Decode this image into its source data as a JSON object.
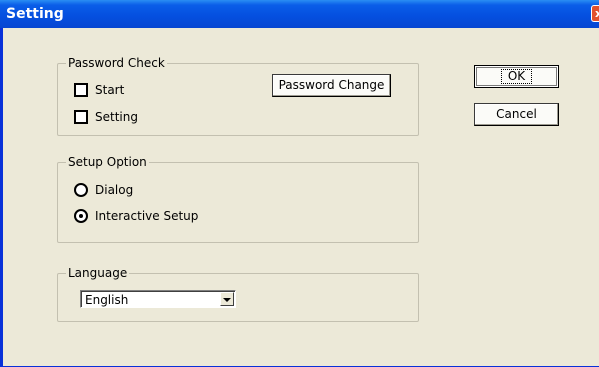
{
  "window": {
    "title": "Setting",
    "close_glyph": "x",
    "title_bar_color": "#0a5ee8",
    "background_color": "#ece9d8"
  },
  "password_check": {
    "legend": "Password Check",
    "start_label": "Start",
    "start_checked": false,
    "setting_label": "Setting",
    "setting_checked": false,
    "change_button": "Password Change"
  },
  "setup_option": {
    "legend": "Setup Option",
    "options": [
      {
        "label": "Dialog",
        "selected": false
      },
      {
        "label": "Interactive Setup",
        "selected": true
      }
    ]
  },
  "language": {
    "legend": "Language",
    "selected": "English"
  },
  "buttons": {
    "ok": "OK",
    "cancel": "Cancel"
  }
}
